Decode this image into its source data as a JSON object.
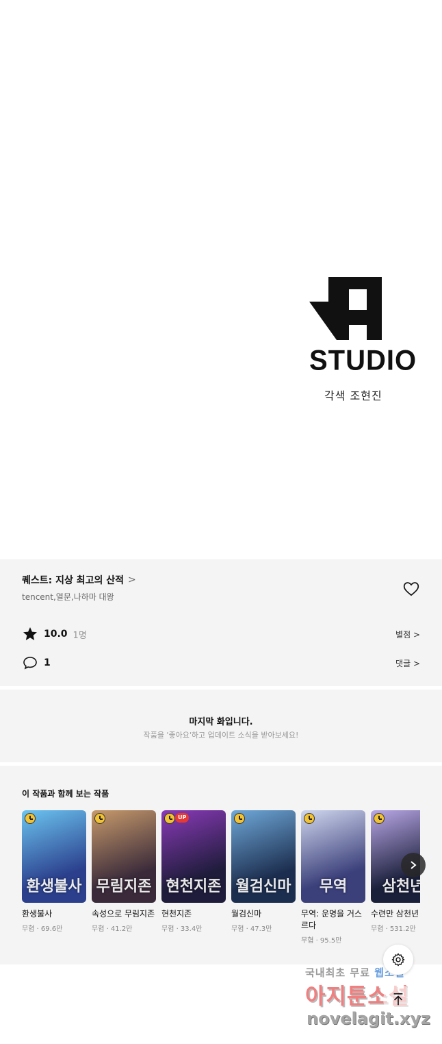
{
  "credits": {
    "studio_name": "STUDIO",
    "credit_line": "각색 조현진"
  },
  "series": {
    "title": "퀘스트: 지상 최고의 산적",
    "chevron": ">",
    "authors": "tencent,열문,나하마 대왕"
  },
  "rating": {
    "score": "10.0",
    "count": "1명",
    "link_label": "별점 >"
  },
  "comments": {
    "count": "1",
    "link_label": "댓글 >"
  },
  "notice": {
    "title": "마지막 화입니다.",
    "subtitle": "작품을 '좋아요'하고 업데이트 소식을 받아보세요!"
  },
  "recommendations": {
    "title": "이 작품과 함께 보는 작품",
    "items": [
      {
        "name": "환생불사",
        "meta": "무협 · 69.6만",
        "art": "환생불사",
        "badge_up": "",
        "colors": [
          "#2b3f8c",
          "#6bc4f0"
        ]
      },
      {
        "name": "속성으로 무림지존",
        "meta": "무협 · 41.2만",
        "art": "무림지존",
        "badge_up": "",
        "colors": [
          "#3a2a3a",
          "#c79a6b"
        ]
      },
      {
        "name": "현천지존",
        "meta": "무협 · 33.4만",
        "art": "현천지존",
        "badge_up": "UP",
        "colors": [
          "#1e1c3a",
          "#8a3ab8"
        ]
      },
      {
        "name": "월검신마",
        "meta": "무협 · 47.3만",
        "art": "월검신마",
        "badge_up": "",
        "colors": [
          "#1c2e4f",
          "#6fa8d8"
        ]
      },
      {
        "name": "무역: 운명을 거스르다",
        "meta": "무협 · 95.5만",
        "art": "무역",
        "badge_up": "",
        "colors": [
          "#3b3f7a",
          "#cfd7ee"
        ]
      },
      {
        "name": "수련만 삼천년",
        "meta": "무협 · 531.2만",
        "art": "삼천년",
        "badge_up": "",
        "colors": [
          "#1a1f3a",
          "#b9a7e6"
        ]
      }
    ]
  },
  "watermark": {
    "line1_a": "국내최초 무료 ",
    "line1_b": "웹소설",
    "line2": "아지툰소설",
    "line3": "novelagit.xyz"
  },
  "icons": {
    "heart": "heart-icon",
    "star": "star-icon",
    "comment": "comment-icon",
    "settings": "gear-icon",
    "scroll_top": "arrow-up-icon",
    "next": "chevron-right-icon"
  }
}
